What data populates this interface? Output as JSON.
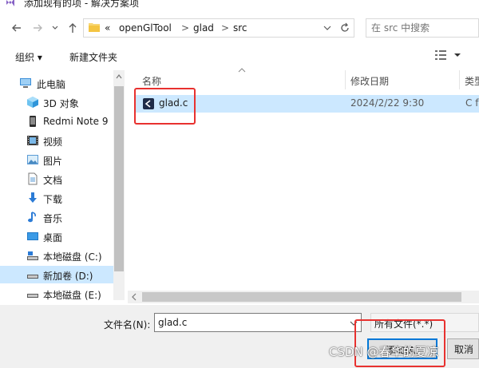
{
  "window": {
    "title": "添加现有的项 - 解决方案项"
  },
  "address": {
    "overflow": "«",
    "crumbs": [
      "openGlTool",
      "glad",
      "src"
    ],
    "separator": ">"
  },
  "search": {
    "placeholder": "在 src 中搜索"
  },
  "toolbar": {
    "organize": "组织 ▾",
    "new_folder": "新建文件夹"
  },
  "sidebar": {
    "items": [
      {
        "label": "此电脑",
        "icon": "computer-icon"
      },
      {
        "label": "3D 对象",
        "icon": "3d-objects-icon"
      },
      {
        "label": "Redmi Note 9",
        "icon": "phone-icon"
      },
      {
        "label": "视频",
        "icon": "video-icon"
      },
      {
        "label": "图片",
        "icon": "picture-icon"
      },
      {
        "label": "文档",
        "icon": "document-icon"
      },
      {
        "label": "下载",
        "icon": "download-icon"
      },
      {
        "label": "音乐",
        "icon": "music-icon"
      },
      {
        "label": "桌面",
        "icon": "desktop-icon"
      },
      {
        "label": "本地磁盘 (C:)",
        "icon": "drive-icon"
      },
      {
        "label": "新加卷 (D:)",
        "icon": "drive-icon"
      },
      {
        "label": "本地磁盘 (E:)",
        "icon": "drive-icon"
      }
    ],
    "selected_index": 10
  },
  "columns": {
    "name": "名称",
    "modified": "修改日期",
    "type": "类型"
  },
  "files": [
    {
      "name": "glad.c",
      "modified": "2024/2/22 9:30",
      "type": "C f",
      "icon": "c-source-file-icon"
    }
  ],
  "footer": {
    "filename_label": "文件名(N):",
    "filename_value": "glad.c",
    "filetype_value": "所有文件(*.*)",
    "add_button": "添加(A)",
    "cancel_button": "取消"
  },
  "watermark": "CSDN @春华的夏凉",
  "colors": {
    "selection": "#cce8ff",
    "highlight_box": "#e8312f",
    "accent": "#0078d7"
  }
}
